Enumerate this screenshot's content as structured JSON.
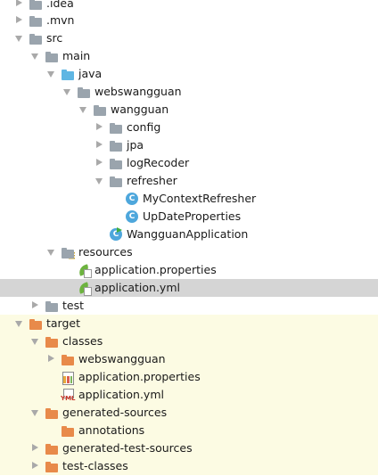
{
  "tree": {
    "nodes": [
      {
        "label": ".idea",
        "arrow": "collapsed",
        "icon": "folder-icon"
      },
      {
        "label": ".mvn",
        "arrow": "collapsed",
        "icon": "folder-icon"
      },
      {
        "label": "src",
        "arrow": "expanded",
        "icon": "folder-icon"
      },
      {
        "label": "main",
        "arrow": "expanded",
        "icon": "folder-icon"
      },
      {
        "label": "java",
        "arrow": "expanded",
        "icon": "source-folder-icon"
      },
      {
        "label": "webswangguan",
        "arrow": "expanded",
        "icon": "package-icon"
      },
      {
        "label": "wangguan",
        "arrow": "expanded",
        "icon": "package-icon"
      },
      {
        "label": "config",
        "arrow": "collapsed",
        "icon": "package-icon"
      },
      {
        "label": "jpa",
        "arrow": "collapsed",
        "icon": "package-icon"
      },
      {
        "label": "logRecoder",
        "arrow": "collapsed",
        "icon": "package-icon"
      },
      {
        "label": "refresher",
        "arrow": "expanded",
        "icon": "package-icon"
      },
      {
        "label": "MyContextRefresher",
        "arrow": "none",
        "icon": "class-icon"
      },
      {
        "label": "UpDateProperties",
        "arrow": "none",
        "icon": "class-icon"
      },
      {
        "label": "WangguanApplication",
        "arrow": "none",
        "icon": "spring-boot-class-icon"
      },
      {
        "label": "resources",
        "arrow": "expanded",
        "icon": "resources-folder-icon"
      },
      {
        "label": "application.properties",
        "arrow": "none",
        "icon": "spring-config-icon"
      },
      {
        "label": "application.yml",
        "arrow": "none",
        "icon": "spring-config-icon"
      },
      {
        "label": "test",
        "arrow": "collapsed",
        "icon": "folder-icon"
      },
      {
        "label": "target",
        "arrow": "expanded",
        "icon": "excluded-folder-icon"
      },
      {
        "label": "classes",
        "arrow": "expanded",
        "icon": "excluded-folder-icon"
      },
      {
        "label": "webswangguan",
        "arrow": "collapsed",
        "icon": "excluded-folder-icon"
      },
      {
        "label": "application.properties",
        "arrow": "none",
        "icon": "properties-file-icon"
      },
      {
        "label": "application.yml",
        "arrow": "none",
        "icon": "yml-file-icon"
      },
      {
        "label": "generated-sources",
        "arrow": "expanded",
        "icon": "excluded-folder-icon"
      },
      {
        "label": "annotations",
        "arrow": "none",
        "icon": "excluded-folder-icon"
      },
      {
        "label": "generated-test-sources",
        "arrow": "collapsed",
        "icon": "excluded-folder-icon"
      },
      {
        "label": "test-classes",
        "arrow": "collapsed",
        "icon": "excluded-folder-icon"
      }
    ],
    "selected_label": "application.yml"
  },
  "colors": {
    "excluded_background": "#fcfbe3",
    "selection_background": "#d5d5d5",
    "folder": "#9aa4ad",
    "source_folder": "#5fb6e3",
    "excluded_folder": "#e88a4a"
  }
}
